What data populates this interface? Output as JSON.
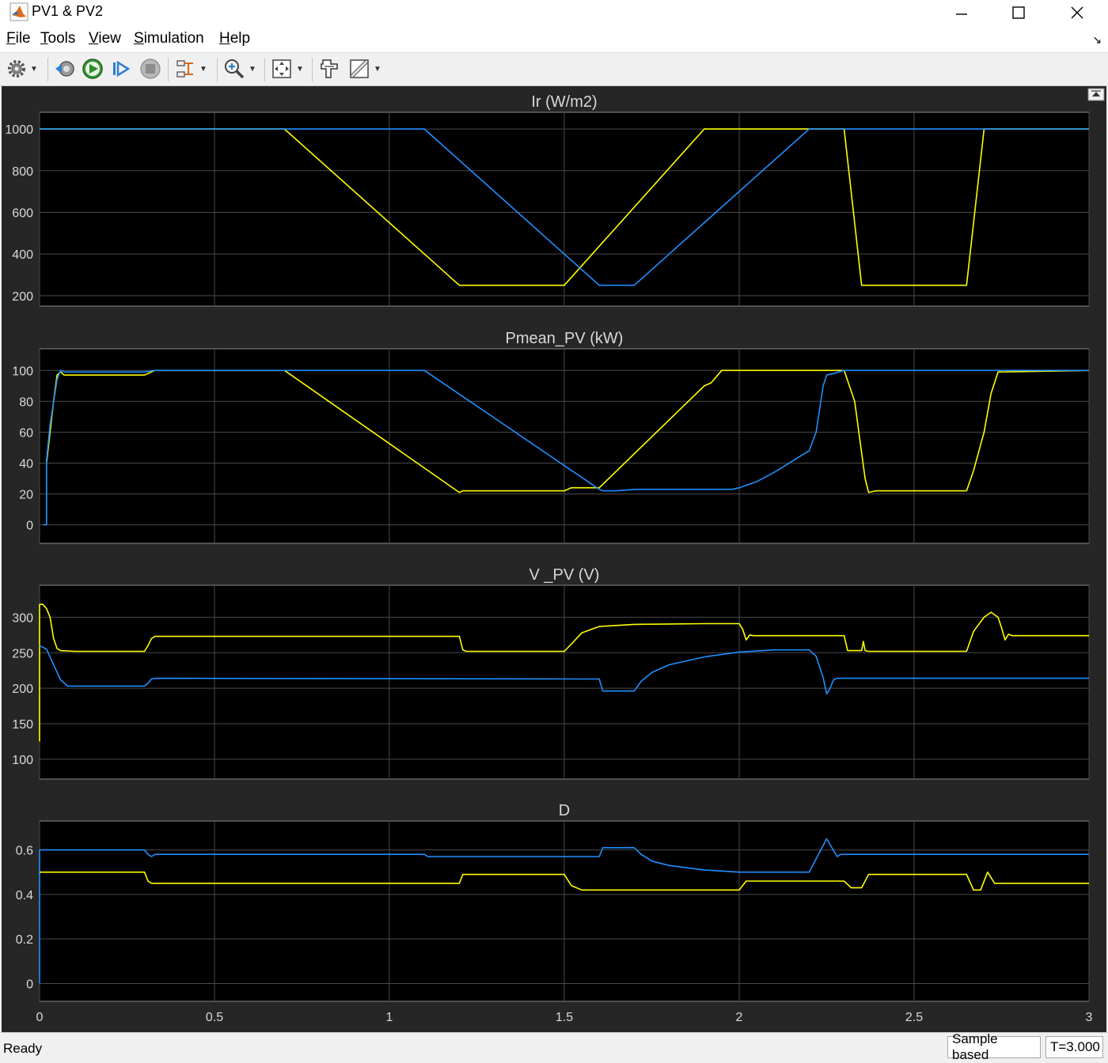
{
  "window": {
    "title": "PV1 & PV2"
  },
  "menu": [
    {
      "label": "File",
      "accel": "F",
      "rest": "ile"
    },
    {
      "label": "Tools",
      "accel": "T",
      "rest": "ools"
    },
    {
      "label": "View",
      "accel": "V",
      "rest": "iew"
    },
    {
      "label": "Simulation",
      "accel": "S",
      "rest": "imulation"
    },
    {
      "label": "Help",
      "accel": "H",
      "rest": "elp"
    }
  ],
  "toolbar_icons": [
    "settings-icon",
    "step-back-icon",
    "run-icon",
    "step-forward-icon",
    "stop-icon",
    "signal-select-icon",
    "zoom-in-icon",
    "fit-to-view-icon",
    "cursor-measure-icon",
    "ruler-measure-icon"
  ],
  "status": {
    "text": "Ready",
    "mode": "Sample based",
    "time": "T=3.000"
  },
  "colors": {
    "background": "#262626",
    "axes_bg": "#000000",
    "series1": "#ffff00",
    "series2": "#1e90ff",
    "grid": "#4a4a4a",
    "text": "#d9d9d9"
  },
  "chart_data": [
    {
      "type": "line",
      "title": "Ir (W/m2)",
      "xlim": [
        0,
        3
      ],
      "ylim": [
        150,
        1080
      ],
      "yticks": [
        200,
        400,
        600,
        800,
        1000
      ],
      "xticks": [
        0,
        0.5,
        1,
        1.5,
        2,
        2.5,
        3
      ],
      "grid": true,
      "series": [
        {
          "color": "yellow",
          "points": [
            [
              0,
              1000
            ],
            [
              0.7,
              1000
            ],
            [
              1.2,
              250
            ],
            [
              1.5,
              250
            ],
            [
              1.9,
              1000
            ],
            [
              2.2,
              1000
            ],
            [
              2.3,
              1000
            ],
            [
              2.35,
              250
            ],
            [
              2.65,
              250
            ],
            [
              2.7,
              1000
            ],
            [
              3,
              1000
            ]
          ]
        },
        {
          "color": "blue",
          "points": [
            [
              0,
              1000
            ],
            [
              1.1,
              1000
            ],
            [
              1.6,
              250
            ],
            [
              1.7,
              250
            ],
            [
              2.2,
              1000
            ],
            [
              3,
              1000
            ]
          ]
        }
      ]
    },
    {
      "type": "line",
      "title": "Pmean_PV (kW)",
      "xlim": [
        0,
        3
      ],
      "ylim": [
        -12,
        114
      ],
      "yticks": [
        0,
        20,
        40,
        60,
        80,
        100
      ],
      "xticks": [
        0,
        0.5,
        1,
        1.5,
        2,
        2.5,
        3
      ],
      "grid": true,
      "series": [
        {
          "color": "yellow",
          "points": [
            [
              0.02,
              0
            ],
            [
              0.02,
              40
            ],
            [
              0.04,
              80
            ],
            [
              0.05,
              97
            ],
            [
              0.06,
              99
            ],
            [
              0.07,
              97
            ],
            [
              0.3,
              97
            ],
            [
              0.33,
              100
            ],
            [
              0.7,
              100
            ],
            [
              1.2,
              21
            ],
            [
              1.21,
              22
            ],
            [
              1.5,
              22
            ],
            [
              1.52,
              24
            ],
            [
              1.6,
              24
            ],
            [
              1.9,
              90
            ],
            [
              1.92,
              92
            ],
            [
              1.95,
              100
            ],
            [
              2.3,
              100
            ],
            [
              2.33,
              80
            ],
            [
              2.36,
              30
            ],
            [
              2.37,
              21
            ],
            [
              2.39,
              22
            ],
            [
              2.65,
              22
            ],
            [
              2.67,
              35
            ],
            [
              2.7,
              60
            ],
            [
              2.72,
              85
            ],
            [
              2.74,
              99
            ],
            [
              3,
              100
            ]
          ]
        },
        {
          "color": "blue",
          "points": [
            [
              0.01,
              0
            ],
            [
              0.02,
              0
            ],
            [
              0.02,
              42
            ],
            [
              0.03,
              65
            ],
            [
              0.05,
              94
            ],
            [
              0.06,
              100
            ],
            [
              0.07,
              99
            ],
            [
              0.3,
              99
            ],
            [
              0.33,
              100
            ],
            [
              1.1,
              100
            ],
            [
              1.6,
              23
            ],
            [
              1.61,
              22
            ],
            [
              1.65,
              22
            ],
            [
              1.7,
              23
            ],
            [
              1.98,
              23
            ],
            [
              2.0,
              24
            ],
            [
              2.05,
              28
            ],
            [
              2.1,
              34
            ],
            [
              2.2,
              48
            ],
            [
              2.22,
              60
            ],
            [
              2.24,
              90
            ],
            [
              2.25,
              97
            ],
            [
              2.27,
              98
            ],
            [
              2.3,
              100
            ],
            [
              3,
              100
            ]
          ]
        }
      ]
    },
    {
      "type": "line",
      "title": "V _PV (V)",
      "xlim": [
        0,
        3
      ],
      "ylim": [
        72,
        345
      ],
      "yticks": [
        100,
        150,
        200,
        250,
        300
      ],
      "xticks": [
        0,
        0.5,
        1,
        1.5,
        2,
        2.5,
        3
      ],
      "grid": true,
      "series": [
        {
          "color": "yellow",
          "points": [
            [
              0,
              125
            ],
            [
              0,
              318
            ],
            [
              0.01,
              318
            ],
            [
              0.02,
              312
            ],
            [
              0.03,
              300
            ],
            [
              0.04,
              270
            ],
            [
              0.05,
              256
            ],
            [
              0.06,
              253
            ],
            [
              0.1,
              252
            ],
            [
              0.3,
              252
            ],
            [
              0.31,
              260
            ],
            [
              0.32,
              270
            ],
            [
              0.33,
              273
            ],
            [
              1.2,
              273
            ],
            [
              1.21,
              254
            ],
            [
              1.22,
              252
            ],
            [
              1.5,
              252
            ],
            [
              1.52,
              262
            ],
            [
              1.55,
              278
            ],
            [
              1.6,
              287
            ],
            [
              1.7,
              290
            ],
            [
              1.9,
              291
            ],
            [
              2.0,
              291
            ],
            [
              2.01,
              283
            ],
            [
              2.02,
              268
            ],
            [
              2.03,
              275
            ],
            [
              2.04,
              274
            ],
            [
              2.3,
              274
            ],
            [
              2.31,
              253
            ],
            [
              2.35,
              253
            ],
            [
              2.355,
              266
            ],
            [
              2.36,
              253
            ],
            [
              2.37,
              252
            ],
            [
              2.65,
              252
            ],
            [
              2.67,
              280
            ],
            [
              2.7,
              300
            ],
            [
              2.72,
              307
            ],
            [
              2.74,
              300
            ],
            [
              2.75,
              285
            ],
            [
              2.76,
              268
            ],
            [
              2.77,
              276
            ],
            [
              2.78,
              274
            ],
            [
              3,
              274
            ]
          ]
        },
        {
          "color": "blue",
          "points": [
            [
              0,
              260
            ],
            [
              0.02,
              255
            ],
            [
              0.04,
              233
            ],
            [
              0.06,
              212
            ],
            [
              0.08,
              203
            ],
            [
              0.3,
              203
            ],
            [
              0.31,
              207
            ],
            [
              0.32,
              213
            ],
            [
              0.33,
              214
            ],
            [
              1.6,
              213
            ],
            [
              1.61,
              196
            ],
            [
              1.62,
              196
            ],
            [
              1.7,
              196
            ],
            [
              1.72,
              210
            ],
            [
              1.75,
              222
            ],
            [
              1.8,
              233
            ],
            [
              1.9,
              244
            ],
            [
              2.0,
              251
            ],
            [
              2.1,
              254
            ],
            [
              2.2,
              254
            ],
            [
              2.22,
              245
            ],
            [
              2.24,
              215
            ],
            [
              2.25,
              192
            ],
            [
              2.26,
              200
            ],
            [
              2.27,
              212
            ],
            [
              2.28,
              214
            ],
            [
              3,
              214
            ]
          ]
        }
      ]
    },
    {
      "type": "line",
      "title": "D",
      "xlim": [
        0,
        3
      ],
      "ylim": [
        -0.08,
        0.73
      ],
      "yticks": [
        0,
        0.2,
        0.4,
        0.6
      ],
      "xticks": [
        0,
        0.5,
        1,
        1.5,
        2,
        2.5,
        3
      ],
      "xticklabels": [
        "0",
        "0.5",
        "1",
        "1.5",
        "2",
        "2.5",
        "3"
      ],
      "grid": true,
      "series": [
        {
          "color": "blue",
          "points": [
            [
              0,
              0
            ],
            [
              0,
              0.6
            ],
            [
              0.3,
              0.6
            ],
            [
              0.31,
              0.58
            ],
            [
              0.32,
              0.57
            ],
            [
              0.33,
              0.58
            ],
            [
              1.1,
              0.58
            ],
            [
              1.11,
              0.57
            ],
            [
              1.6,
              0.57
            ],
            [
              1.61,
              0.61
            ],
            [
              1.7,
              0.61
            ],
            [
              1.72,
              0.58
            ],
            [
              1.75,
              0.55
            ],
            [
              1.8,
              0.53
            ],
            [
              1.9,
              0.51
            ],
            [
              2.0,
              0.5
            ],
            [
              2.2,
              0.5
            ],
            [
              2.25,
              0.65
            ],
            [
              2.28,
              0.57
            ],
            [
              2.29,
              0.58
            ],
            [
              3,
              0.58
            ]
          ]
        },
        {
          "color": "yellow",
          "points": [
            [
              0,
              0.5
            ],
            [
              0.3,
              0.5
            ],
            [
              0.31,
              0.46
            ],
            [
              0.32,
              0.45
            ],
            [
              1.1,
              0.45
            ],
            [
              1.2,
              0.45
            ],
            [
              1.21,
              0.49
            ],
            [
              1.5,
              0.49
            ],
            [
              1.52,
              0.44
            ],
            [
              1.55,
              0.42
            ],
            [
              2.0,
              0.42
            ],
            [
              2.02,
              0.46
            ],
            [
              2.3,
              0.46
            ],
            [
              2.32,
              0.43
            ],
            [
              2.35,
              0.43
            ],
            [
              2.37,
              0.49
            ],
            [
              2.65,
              0.49
            ],
            [
              2.67,
              0.42
            ],
            [
              2.69,
              0.42
            ],
            [
              2.71,
              0.5
            ],
            [
              2.73,
              0.45
            ],
            [
              3,
              0.45
            ]
          ]
        }
      ]
    }
  ]
}
